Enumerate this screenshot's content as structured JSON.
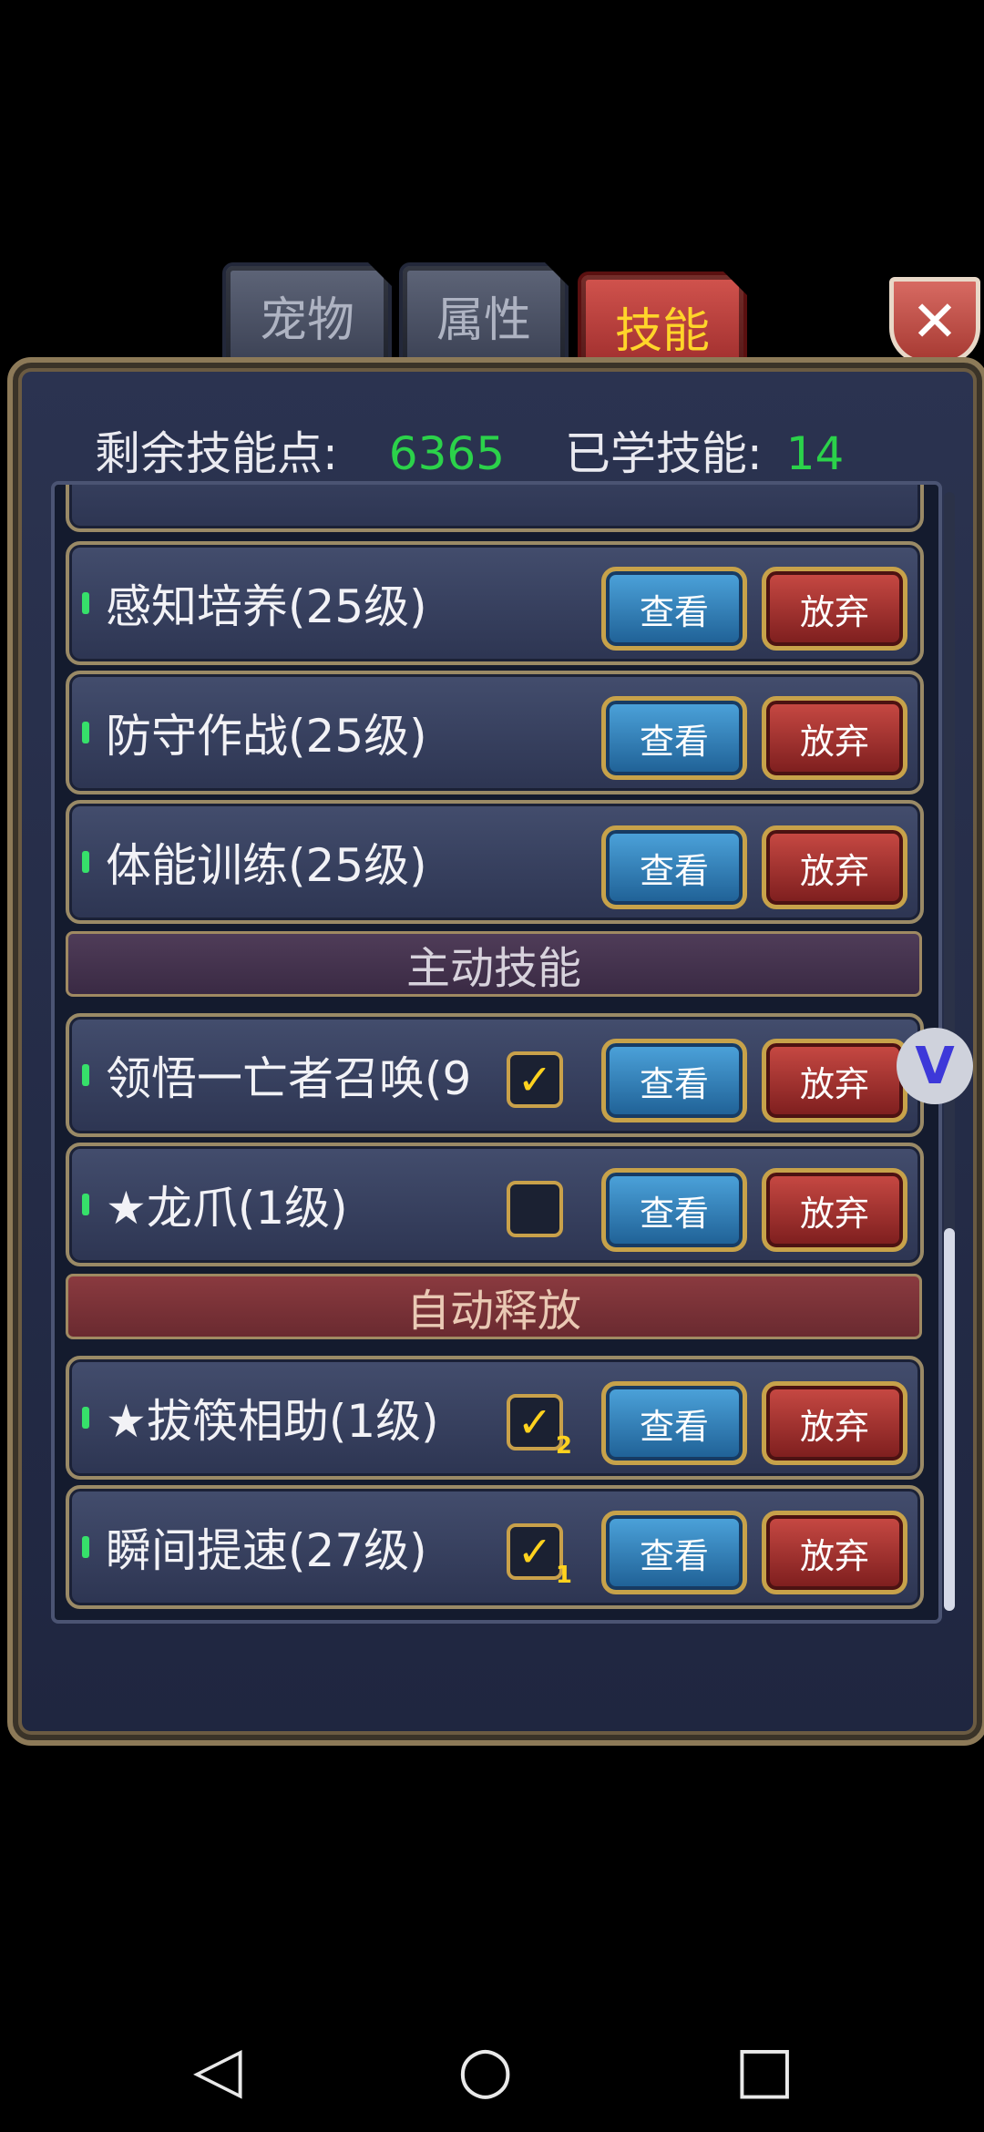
{
  "tabs": [
    {
      "label": "宠物",
      "state": "inactive"
    },
    {
      "label": "属性",
      "state": "inactive"
    },
    {
      "label": "技能",
      "state": "active"
    }
  ],
  "close": {
    "glyph": "✕"
  },
  "header": {
    "remaining_label": "剩余技能点:",
    "remaining_value": "6365",
    "learned_label": "已学技能:",
    "learned_value": "14"
  },
  "skills": [
    {
      "name": "感知培养(25级)",
      "view": "查看",
      "drop": "放弃"
    },
    {
      "name": "防守作战(25级)",
      "view": "查看",
      "drop": "放弃"
    },
    {
      "name": "体能训练(25级)",
      "view": "查看",
      "drop": "放弃"
    }
  ],
  "sections": {
    "active": "主动技能",
    "auto": "自动释放"
  },
  "active_skills": [
    {
      "name": "领悟一亡者召唤(9",
      "checked": true,
      "check": "✓",
      "view": "查看",
      "drop": "放弃"
    },
    {
      "name": "★龙爪(1级)",
      "checked": false,
      "check": "",
      "view": "查看",
      "drop": "放弃"
    }
  ],
  "auto_skills": [
    {
      "name": "★拔筷相助(1级)",
      "checked": true,
      "check": "✓",
      "order": "2",
      "view": "查看",
      "drop": "放弃"
    },
    {
      "name": "瞬间提速(27级)",
      "checked": true,
      "check": "✓",
      "order": "1",
      "view": "查看",
      "drop": "放弃"
    }
  ],
  "nav": {
    "back": "◁",
    "home": "○",
    "recent": "□"
  }
}
